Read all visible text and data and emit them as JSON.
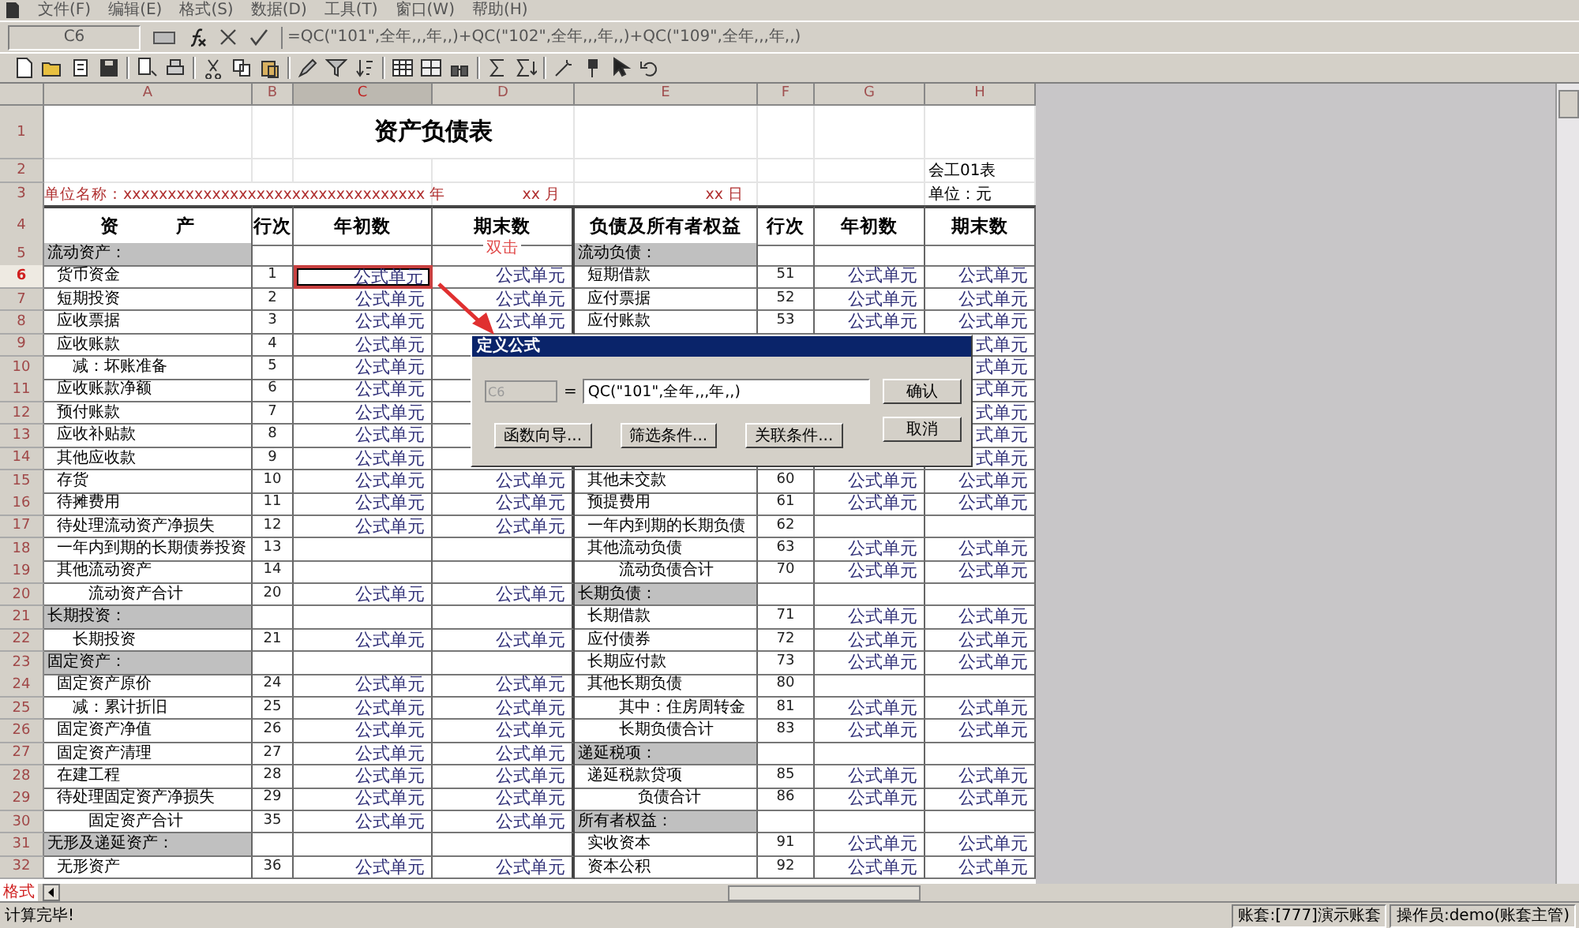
{
  "menu": [
    "文件(F)",
    "编辑(E)",
    "格式(S)",
    "数据(D)",
    "工具(T)",
    "窗口(W)",
    "帮助(H)"
  ],
  "formula_bar": {
    "cell_name": "C6",
    "formula": "=QC(\"101\",全年,,,年,,)+QC(\"102\",全年,,,年,,)+QC(\"109\",全年,,,年,,)"
  },
  "column_headers": [
    {
      "label": "A",
      "selected": false
    },
    {
      "label": "B",
      "selected": false
    },
    {
      "label": "C",
      "selected": true
    },
    {
      "label": "D",
      "selected": false
    },
    {
      "label": "E",
      "selected": false
    },
    {
      "label": "F",
      "selected": false
    },
    {
      "label": "G",
      "selected": false
    },
    {
      "label": "H",
      "selected": false
    }
  ],
  "row_headers": [
    {
      "label": "1",
      "selected": false
    },
    {
      "label": "2",
      "selected": false
    },
    {
      "label": "3",
      "selected": false
    },
    {
      "label": "4",
      "selected": false
    },
    {
      "label": "5",
      "selected": false
    },
    {
      "label": "6",
      "selected": true
    },
    {
      "label": "7",
      "selected": false
    },
    {
      "label": "8",
      "selected": false
    },
    {
      "label": "9",
      "selected": false
    },
    {
      "label": "10",
      "selected": false
    },
    {
      "label": "11",
      "selected": false
    },
    {
      "label": "12",
      "selected": false
    },
    {
      "label": "13",
      "selected": false
    },
    {
      "label": "14",
      "selected": false
    },
    {
      "label": "15",
      "selected": false
    },
    {
      "label": "16",
      "selected": false
    },
    {
      "label": "17",
      "selected": false
    },
    {
      "label": "18",
      "selected": false
    },
    {
      "label": "19",
      "selected": false
    },
    {
      "label": "20",
      "selected": false
    },
    {
      "label": "21",
      "selected": false
    },
    {
      "label": "22",
      "selected": false
    },
    {
      "label": "23",
      "selected": false
    },
    {
      "label": "24",
      "selected": false
    },
    {
      "label": "25",
      "selected": false
    },
    {
      "label": "26",
      "selected": false
    },
    {
      "label": "27",
      "selected": false
    },
    {
      "label": "28",
      "selected": false
    },
    {
      "label": "29",
      "selected": false
    },
    {
      "label": "30",
      "selected": false
    },
    {
      "label": "31",
      "selected": false
    },
    {
      "label": "32",
      "selected": false
    }
  ],
  "report": {
    "title": "资产负债表",
    "form_code": "会工01表",
    "unit_name": "单位名称：xxxxxxxxxxxxxxxxxxxxxxxxxxxxxx",
    "year": "xxxx 年",
    "month": "xx 月",
    "day": "xx 日",
    "currency_unit": "单位：元",
    "headers": [
      "资　　　产",
      "行次",
      "年初数",
      "期末数",
      "负债及所有者权益",
      "行次",
      "年初数",
      "期末数"
    ]
  },
  "rows": [
    {
      "left": {
        "kind": "section",
        "name": "流动资产："
      },
      "right": {
        "kind": "section",
        "name": "流动负债："
      }
    },
    {
      "left": {
        "kind": "item",
        "name": "货币资金",
        "no": "1"
      },
      "c": "公式单元",
      "d": "公式单元",
      "right": {
        "kind": "item",
        "name": "短期借款",
        "no": "51"
      },
      "g": "公式单元",
      "h": "公式单元"
    },
    {
      "left": {
        "kind": "item",
        "name": "短期投资",
        "no": "2"
      },
      "c": "公式单元",
      "d": "公式单元",
      "right": {
        "kind": "item",
        "name": "应付票据",
        "no": "52"
      },
      "g": "公式单元",
      "h": "公式单元"
    },
    {
      "left": {
        "kind": "item",
        "name": "应收票据",
        "no": "3"
      },
      "c": "公式单元",
      "d": "公式单元",
      "right": {
        "kind": "item",
        "name": "应付账款",
        "no": "53"
      },
      "g": "公式单元",
      "h": "公式单元"
    },
    {
      "left": {
        "kind": "item",
        "name": "应收账款",
        "no": "4"
      },
      "c": "公式单元",
      "h": "式单元"
    },
    {
      "left": {
        "kind": "sub",
        "name": "减：坏账准备",
        "no": "5"
      },
      "c": "公式单元",
      "h": "式单元"
    },
    {
      "left": {
        "kind": "item",
        "name": "应收账款净额",
        "no": "6"
      },
      "c": "公式单元",
      "h": "式单元"
    },
    {
      "left": {
        "kind": "item",
        "name": "预付账款",
        "no": "7"
      },
      "c": "公式单元",
      "h": "式单元"
    },
    {
      "left": {
        "kind": "item",
        "name": "应收补贴款",
        "no": "8"
      },
      "c": "公式单元",
      "h": "式单元"
    },
    {
      "left": {
        "kind": "item",
        "name": "其他应收款",
        "no": "9"
      },
      "c": "公式单元",
      "h": "式单元"
    },
    {
      "left": {
        "kind": "item",
        "name": "存货",
        "no": "10"
      },
      "c": "公式单元",
      "d": "公式单元",
      "right": {
        "kind": "item",
        "name": "其他未交款",
        "no": "60"
      },
      "g": "公式单元",
      "h": "公式单元"
    },
    {
      "left": {
        "kind": "item",
        "name": "待摊费用",
        "no": "11"
      },
      "c": "公式单元",
      "d": "公式单元",
      "right": {
        "kind": "item",
        "name": "预提费用",
        "no": "61"
      },
      "g": "公式单元",
      "h": "公式单元"
    },
    {
      "left": {
        "kind": "item",
        "name": "待处理流动资产净损失",
        "no": "12"
      },
      "c": "公式单元",
      "d": "公式单元",
      "right": {
        "kind": "item",
        "name": "一年内到期的长期负债",
        "no": "62"
      }
    },
    {
      "left": {
        "kind": "item",
        "name": "一年内到期的长期债券投资",
        "no": "13"
      },
      "right": {
        "kind": "item",
        "name": "其他流动负债",
        "no": "63"
      },
      "g": "公式单元",
      "h": "公式单元"
    },
    {
      "left": {
        "kind": "item",
        "name": "其他流动资产",
        "no": "14"
      },
      "right": {
        "kind": "total",
        "name": "流动负债合计",
        "no": "70"
      },
      "g": "公式单元",
      "h": "公式单元"
    },
    {
      "left": {
        "kind": "total",
        "name": "流动资产合计",
        "no": "20"
      },
      "c": "公式单元",
      "d": "公式单元",
      "right": {
        "kind": "section",
        "name": "长期负债："
      }
    },
    {
      "left": {
        "kind": "section",
        "name": "长期投资："
      },
      "right": {
        "kind": "item",
        "name": "长期借款",
        "no": "71"
      },
      "g": "公式单元",
      "h": "公式单元"
    },
    {
      "left": {
        "kind": "sub",
        "name": "长期投资",
        "no": "21"
      },
      "c": "公式单元",
      "d": "公式单元",
      "right": {
        "kind": "item",
        "name": "应付债券",
        "no": "72"
      },
      "g": "公式单元",
      "h": "公式单元"
    },
    {
      "left": {
        "kind": "section",
        "name": "固定资产："
      },
      "right": {
        "kind": "item",
        "name": "长期应付款",
        "no": "73"
      },
      "g": "公式单元",
      "h": "公式单元"
    },
    {
      "left": {
        "kind": "item",
        "name": "固定资产原价",
        "no": "24"
      },
      "c": "公式单元",
      "d": "公式单元",
      "right": {
        "kind": "item",
        "name": "其他长期负债",
        "no": "80"
      }
    },
    {
      "left": {
        "kind": "sub",
        "name": "减：累计折旧",
        "no": "25"
      },
      "c": "公式单元",
      "d": "公式单元",
      "right": {
        "kind": "total",
        "name": "其中：住房周转金",
        "no": "81"
      },
      "g": "公式单元",
      "h": "公式单元"
    },
    {
      "left": {
        "kind": "item",
        "name": "固定资产净值",
        "no": "26"
      },
      "c": "公式单元",
      "d": "公式单元",
      "right": {
        "kind": "total",
        "name": "长期负债合计",
        "no": "83"
      },
      "g": "公式单元",
      "h": "公式单元"
    },
    {
      "left": {
        "kind": "item",
        "name": "固定资产清理",
        "no": "27"
      },
      "c": "公式单元",
      "d": "公式单元",
      "right": {
        "kind": "section",
        "name": "递延税项："
      }
    },
    {
      "left": {
        "kind": "item",
        "name": "在建工程",
        "no": "28"
      },
      "c": "公式单元",
      "d": "公式单元",
      "right": {
        "kind": "item",
        "name": "递延税款贷项",
        "no": "85"
      },
      "g": "公式单元",
      "h": "公式单元"
    },
    {
      "left": {
        "kind": "item",
        "name": "待处理固定资产净损失",
        "no": "29"
      },
      "c": "公式单元",
      "d": "公式单元",
      "right": {
        "kind": "grand_total",
        "name": "负债合计",
        "no": "86"
      },
      "g": "公式单元",
      "h": "公式单元"
    },
    {
      "left": {
        "kind": "total",
        "name": "固定资产合计",
        "no": "35"
      },
      "c": "公式单元",
      "d": "公式单元",
      "right": {
        "kind": "section",
        "name": "所有者权益："
      }
    },
    {
      "left": {
        "kind": "section",
        "name": "无形及递延资产："
      },
      "right": {
        "kind": "item",
        "name": "实收资本",
        "no": "91"
      },
      "g": "公式单元",
      "h": "公式单元"
    },
    {
      "left": {
        "kind": "item",
        "name": "无形资产",
        "no": "36"
      },
      "c": "公式单元",
      "d": "公式单元",
      "right": {
        "kind": "item",
        "name": "资本公积",
        "no": "92"
      },
      "g": "公式单元",
      "h": "公式单元"
    }
  ],
  "annotation": {
    "text": "双击"
  },
  "dialog": {
    "title": "定义公式",
    "cell": "C6",
    "equals": "=",
    "formula": "QC(\"101\",全年,,,年,,)",
    "ok": "确认",
    "cancel": "取消",
    "buttons": [
      "函数向导...",
      "筛选条件...",
      "关联条件..."
    ]
  },
  "sheet_tabs": [
    {
      "label": "格式",
      "selected": true
    }
  ],
  "status_bar": {
    "message": "计算完毕!",
    "account": "账套:[777]演示账套",
    "operator": "操作员:demo(账套主管)"
  }
}
